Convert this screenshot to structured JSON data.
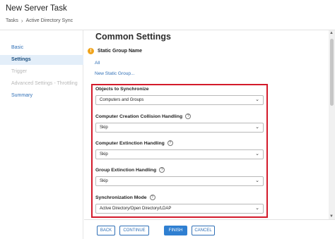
{
  "header": {
    "title": "New Server Task",
    "breadcrumb": [
      "Tasks",
      "Active Directory Sync"
    ]
  },
  "sidebar": {
    "items": [
      {
        "label": "Basic",
        "state": "link"
      },
      {
        "label": "Settings",
        "state": "active"
      },
      {
        "label": "Trigger",
        "state": "disabled"
      },
      {
        "label": "Advanced Settings - Throttling",
        "state": "disabled"
      },
      {
        "label": "Summary",
        "state": "link"
      }
    ]
  },
  "main": {
    "section_title": "Common Settings",
    "static_group": {
      "title": "Static Group Name",
      "value": "All",
      "action": "New Static Group..."
    },
    "fields": [
      {
        "label": "Objects to Synchronize",
        "value": "Computers and Groups",
        "help": false
      },
      {
        "label": "Computer Creation Collision Handling",
        "value": "Skip",
        "help": true
      },
      {
        "label": "Computer Extinction Handling",
        "value": "Skip",
        "help": true
      },
      {
        "label": "Group Extinction Handling",
        "value": "Skip",
        "help": true
      },
      {
        "label": "Synchronization Mode",
        "value": "Active Directory/Open Directory/LDAP",
        "help": true
      }
    ]
  },
  "footer": {
    "back": "BACK",
    "continue": "CONTINUE",
    "finish": "FINISH",
    "cancel": "CANCEL"
  },
  "colors": {
    "accent": "#2f7fd1",
    "highlight_border": "#d31a2a",
    "warning": "#f0a41c",
    "nav_active_bg": "#e3eef9"
  }
}
